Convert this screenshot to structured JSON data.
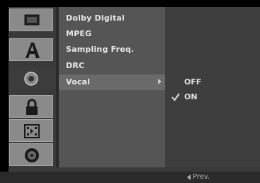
{
  "menu": {
    "items": [
      {
        "label": "Dolby Digital"
      },
      {
        "label": "MPEG"
      },
      {
        "label": "Sampling Freq."
      },
      {
        "label": "DRC"
      },
      {
        "label": "Vocal"
      }
    ]
  },
  "submenu": {
    "options": [
      {
        "label": "OFF"
      },
      {
        "label": "ON"
      }
    ]
  },
  "footer": {
    "prev_label": "Prev."
  },
  "icons": [
    "disc-icon",
    "language-a-icon",
    "audio-speaker-icon",
    "lock-icon",
    "film-icon",
    "disc-settings-icon"
  ],
  "colors": {
    "panel": "#3a3a3a",
    "highlight": "#6a6a6a",
    "tile": "#8a8a8a"
  }
}
